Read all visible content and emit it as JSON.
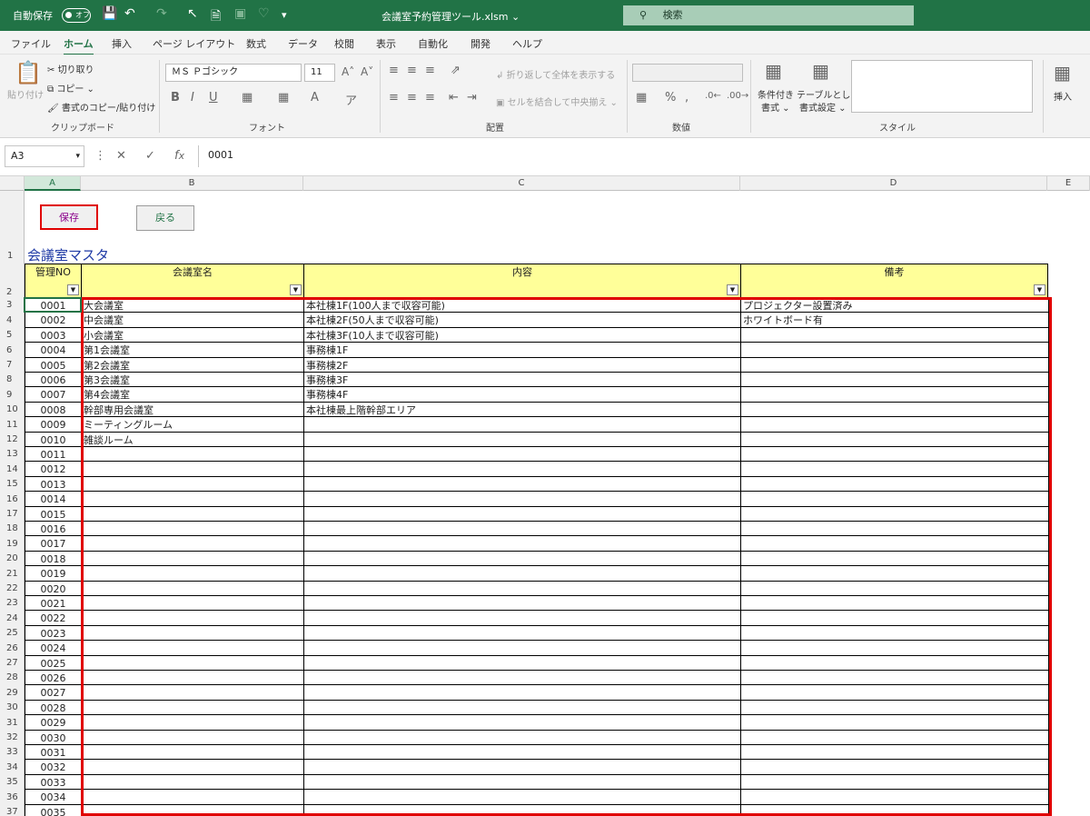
{
  "title_bar": {
    "autosave_label": "自動保存",
    "autosave_state": "オフ",
    "document_title": "会議室予約管理ツール.xlsm ⌄",
    "search_placeholder": "検索"
  },
  "menu": [
    "ファイル",
    "ホーム",
    "挿入",
    "ページ レイアウト",
    "数式",
    "データ",
    "校閲",
    "表示",
    "自動化",
    "開発",
    "ヘルプ"
  ],
  "active_menu": "ホーム",
  "ribbon": {
    "clipboard": {
      "paste": "貼り付け",
      "cut": "切り取り",
      "copy": "コピー ⌄",
      "format_painter": "書式のコピー/貼り付け",
      "group": "クリップボード"
    },
    "font": {
      "name": "ＭＳ Ｐゴシック",
      "size": "11",
      "group": "フォント"
    },
    "alignment": {
      "wrap": "折り返して全体を表示する",
      "merge": "セルを結合して中央揃え ⌄",
      "group": "配置"
    },
    "number": {
      "group": "数値"
    },
    "styles": {
      "conditional": "条件付き",
      "conditional2": "書式 ⌄",
      "table": "テーブルとして",
      "table2": "書式設定 ⌄",
      "group": "スタイル"
    },
    "cells": {
      "insert": "挿入"
    }
  },
  "formula_bar": {
    "name_box": "A3",
    "value": "0001"
  },
  "columns": [
    "A",
    "B",
    "C",
    "D",
    "E"
  ],
  "buttons": {
    "save": "保存",
    "back": "戻る"
  },
  "sheet_title": "会議室マスタ",
  "headers": {
    "no": "管理NO",
    "name": "会議室名",
    "content": "内容",
    "notes": "備考"
  },
  "row_numbers": [
    "1",
    "2",
    "3",
    "4",
    "5",
    "6",
    "7",
    "8",
    "9",
    "10",
    "11",
    "12",
    "13",
    "14",
    "15",
    "16",
    "17",
    "18",
    "19",
    "20",
    "21",
    "22",
    "23",
    "24",
    "25",
    "26",
    "27",
    "28",
    "29",
    "30",
    "31",
    "32",
    "33",
    "34",
    "35",
    "36",
    "37"
  ],
  "rows": [
    {
      "no": "0001",
      "name": "大会議室",
      "content": "本社棟1F(100人まで収容可能)",
      "notes": "プロジェクター設置済み"
    },
    {
      "no": "0002",
      "name": "中会議室",
      "content": "本社棟2F(50人まで収容可能)",
      "notes": "ホワイトボード有"
    },
    {
      "no": "0003",
      "name": "小会議室",
      "content": "本社棟3F(10人まで収容可能)",
      "notes": ""
    },
    {
      "no": "0004",
      "name": "第1会議室",
      "content": "事務棟1F",
      "notes": ""
    },
    {
      "no": "0005",
      "name": "第2会議室",
      "content": "事務棟2F",
      "notes": ""
    },
    {
      "no": "0006",
      "name": "第3会議室",
      "content": "事務棟3F",
      "notes": ""
    },
    {
      "no": "0007",
      "name": "第4会議室",
      "content": "事務棟4F",
      "notes": ""
    },
    {
      "no": "0008",
      "name": "幹部専用会議室",
      "content": "本社棟最上階幹部エリア",
      "notes": ""
    },
    {
      "no": "0009",
      "name": "ミーティングルーム",
      "content": "",
      "notes": ""
    },
    {
      "no": "0010",
      "name": "雑談ルーム",
      "content": "",
      "notes": ""
    },
    {
      "no": "0011",
      "name": "",
      "content": "",
      "notes": ""
    },
    {
      "no": "0012",
      "name": "",
      "content": "",
      "notes": ""
    },
    {
      "no": "0013",
      "name": "",
      "content": "",
      "notes": ""
    },
    {
      "no": "0014",
      "name": "",
      "content": "",
      "notes": ""
    },
    {
      "no": "0015",
      "name": "",
      "content": "",
      "notes": ""
    },
    {
      "no": "0016",
      "name": "",
      "content": "",
      "notes": ""
    },
    {
      "no": "0017",
      "name": "",
      "content": "",
      "notes": ""
    },
    {
      "no": "0018",
      "name": "",
      "content": "",
      "notes": ""
    },
    {
      "no": "0019",
      "name": "",
      "content": "",
      "notes": ""
    },
    {
      "no": "0020",
      "name": "",
      "content": "",
      "notes": ""
    },
    {
      "no": "0021",
      "name": "",
      "content": "",
      "notes": ""
    },
    {
      "no": "0022",
      "name": "",
      "content": "",
      "notes": ""
    },
    {
      "no": "0023",
      "name": "",
      "content": "",
      "notes": ""
    },
    {
      "no": "0024",
      "name": "",
      "content": "",
      "notes": ""
    },
    {
      "no": "0025",
      "name": "",
      "content": "",
      "notes": ""
    },
    {
      "no": "0026",
      "name": "",
      "content": "",
      "notes": ""
    },
    {
      "no": "0027",
      "name": "",
      "content": "",
      "notes": ""
    },
    {
      "no": "0028",
      "name": "",
      "content": "",
      "notes": ""
    },
    {
      "no": "0029",
      "name": "",
      "content": "",
      "notes": ""
    },
    {
      "no": "0030",
      "name": "",
      "content": "",
      "notes": ""
    },
    {
      "no": "0031",
      "name": "",
      "content": "",
      "notes": ""
    },
    {
      "no": "0032",
      "name": "",
      "content": "",
      "notes": ""
    },
    {
      "no": "0033",
      "name": "",
      "content": "",
      "notes": ""
    },
    {
      "no": "0034",
      "name": "",
      "content": "",
      "notes": ""
    },
    {
      "no": "0035",
      "name": "",
      "content": "",
      "notes": ""
    }
  ],
  "colors": {
    "excel_green": "#217346",
    "header_fill": "#ffff99",
    "highlight": "#e00000",
    "title_text": "#1f3aa5"
  },
  "icons": [
    "save-icon",
    "undo-icon",
    "redo-icon",
    "pointer-icon",
    "search-icon",
    "filter-dropdown-icon"
  ]
}
